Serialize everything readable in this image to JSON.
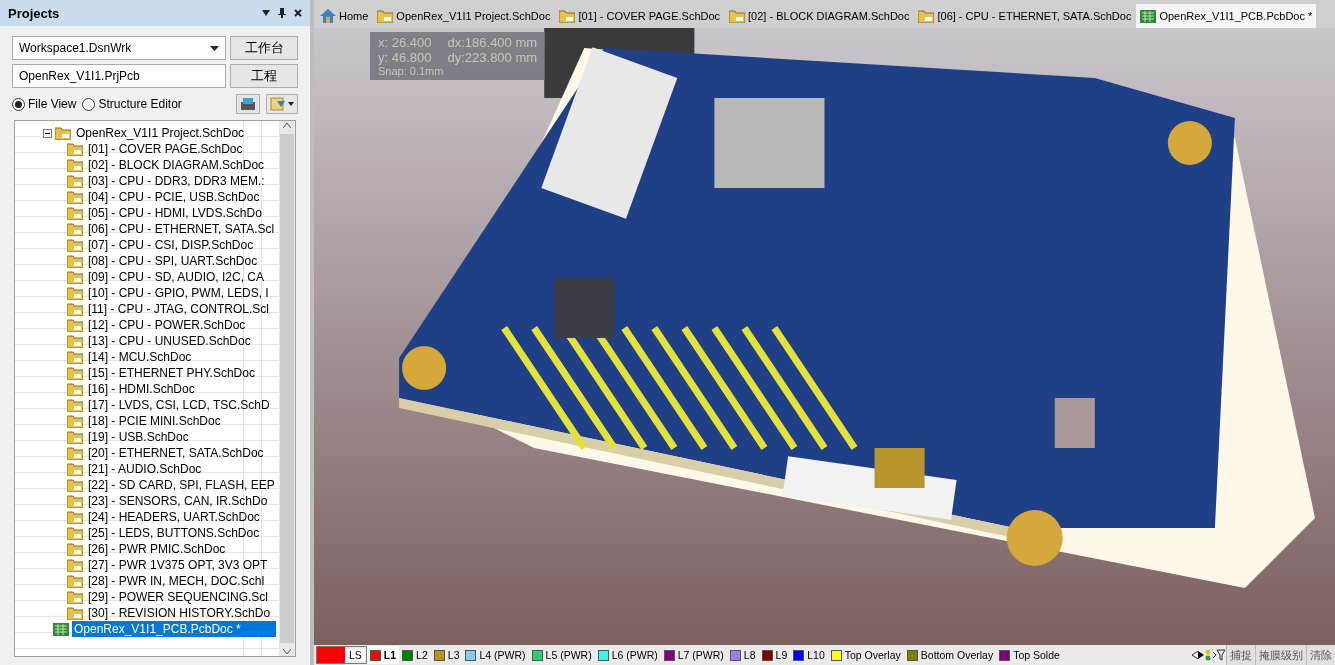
{
  "panel": {
    "title": "Projects",
    "workspace": {
      "value": "Workspace1.DsnWrk",
      "button": "工作台"
    },
    "project": {
      "value": "OpenRex_V1I1.PrjPcb",
      "button": "工程"
    },
    "view_options": [
      {
        "label": "File View",
        "selected": true
      },
      {
        "label": "Structure Editor",
        "selected": false
      }
    ],
    "tree": [
      {
        "label": "OpenRex_V1I1 Project.SchDoc",
        "kind": "sch",
        "expanded": true,
        "selected": false,
        "children": [
          {
            "label": "[01] - COVER PAGE.SchDoc",
            "kind": "sch",
            "selected": false
          },
          {
            "label": "[02] - BLOCK DIAGRAM.SchDoc",
            "kind": "sch",
            "selected": false
          },
          {
            "label": "[03] - CPU - DDR3, DDR3 MEM.:",
            "kind": "sch",
            "selected": false
          },
          {
            "label": "[04] - CPU - PCIE, USB.SchDoc",
            "kind": "sch",
            "selected": false
          },
          {
            "label": "[05] - CPU - HDMI, LVDS.SchDo",
            "kind": "sch",
            "selected": false
          },
          {
            "label": "[06] - CPU - ETHERNET, SATA.Scl",
            "kind": "sch",
            "selected": false
          },
          {
            "label": "[07] - CPU - CSI, DISP.SchDoc",
            "kind": "sch",
            "selected": false
          },
          {
            "label": "[08] - CPU - SPI, UART.SchDoc",
            "kind": "sch",
            "selected": false
          },
          {
            "label": "[09] - CPU - SD, AUDIO, I2C, CA",
            "kind": "sch",
            "selected": false
          },
          {
            "label": "[10] - CPU - GPIO, PWM, LEDS, I",
            "kind": "sch",
            "selected": false
          },
          {
            "label": "[11] - CPU - JTAG, CONTROL.Scl",
            "kind": "sch",
            "selected": false
          },
          {
            "label": "[12] - CPU - POWER.SchDoc",
            "kind": "sch",
            "selected": false
          },
          {
            "label": "[13] - CPU - UNUSED.SchDoc",
            "kind": "sch",
            "selected": false
          },
          {
            "label": "[14] - MCU.SchDoc",
            "kind": "sch",
            "selected": false
          },
          {
            "label": "[15] - ETHERNET PHY.SchDoc",
            "kind": "sch",
            "selected": false
          },
          {
            "label": "[16] - HDMI.SchDoc",
            "kind": "sch",
            "selected": false
          },
          {
            "label": "[17] - LVDS, CSI, LCD, TSC.SchD",
            "kind": "sch",
            "selected": false
          },
          {
            "label": "[18] - PCIE MINI.SchDoc",
            "kind": "sch",
            "selected": false
          },
          {
            "label": "[19] - USB.SchDoc",
            "kind": "sch",
            "selected": false
          },
          {
            "label": "[20] - ETHERNET, SATA.SchDoc",
            "kind": "sch",
            "selected": false
          },
          {
            "label": "[21] - AUDIO.SchDoc",
            "kind": "sch",
            "selected": false
          },
          {
            "label": "[22] - SD CARD, SPI, FLASH, EEP",
            "kind": "sch",
            "selected": false
          },
          {
            "label": "[23] - SENSORS, CAN, IR.SchDo",
            "kind": "sch",
            "selected": false
          },
          {
            "label": "[24] - HEADERS, UART.SchDoc",
            "kind": "sch",
            "selected": false
          },
          {
            "label": "[25] - LEDS, BUTTONS.SchDoc",
            "kind": "sch",
            "selected": false
          },
          {
            "label": "[26] - PWR PMIC.SchDoc",
            "kind": "sch",
            "selected": false
          },
          {
            "label": "[27] - PWR 1V375 OPT, 3V3 OPT",
            "kind": "sch",
            "selected": false
          },
          {
            "label": "[28] - PWR IN, MECH, DOC.SchI",
            "kind": "sch",
            "selected": false
          },
          {
            "label": "[29] - POWER SEQUENCING.Scl",
            "kind": "sch",
            "selected": false
          },
          {
            "label": "[30] - REVISION HISTORY.SchDo",
            "kind": "sch",
            "selected": false
          }
        ]
      },
      {
        "label": "OpenRex_V1I1_PCB.PcbDoc *",
        "kind": "pcb",
        "selected": true
      }
    ]
  },
  "tabs": [
    {
      "label": "Home",
      "kind": "home",
      "selected": false
    },
    {
      "label": "OpenRex_V1I1 Project.SchDoc",
      "kind": "sch",
      "selected": false
    },
    {
      "label": "[01] - COVER PAGE.SchDoc",
      "kind": "sch",
      "selected": false
    },
    {
      "label": "[02] - BLOCK DIAGRAM.SchDoc",
      "kind": "sch",
      "selected": false
    },
    {
      "label": "[06] - CPU - ETHERNET, SATA.SchDoc",
      "kind": "sch",
      "selected": false
    },
    {
      "label": "OpenRex_V1I1_PCB.PcbDoc *",
      "kind": "pcb",
      "selected": true
    }
  ],
  "view": {
    "kind": "picture",
    "coordinates": [
      "x: 26.400",
      "dx:186.400 mm",
      "y: 46.800",
      "dy:223.800 mm"
    ],
    "snap": "Snap: 0.1mm"
  },
  "layer_bar": {
    "current": {
      "label": "LS",
      "color": "#ff0000"
    },
    "layers": [
      {
        "label": "L1",
        "color": "#ff0000",
        "selected": true
      },
      {
        "label": "L2",
        "color": "#008000",
        "selected": false
      },
      {
        "label": "L3",
        "color": "#b8961e",
        "selected": false
      },
      {
        "label": "L4 (PWR)",
        "color": "#87ceeb",
        "selected": false
      },
      {
        "label": "L5 (PWR)",
        "color": "#2ecc71",
        "selected": false
      },
      {
        "label": "L6 (PWR)",
        "color": "#40f0f0",
        "selected": false
      },
      {
        "label": "L7 (PWR)",
        "color": "#800080",
        "selected": false
      },
      {
        "label": "L8",
        "color": "#9b7ee8",
        "selected": false
      },
      {
        "label": "L9",
        "color": "#800000",
        "selected": false
      },
      {
        "label": "L10",
        "color": "#0000ff",
        "selected": false
      },
      {
        "label": "Top Overlay",
        "color": "#ffff00",
        "selected": false
      },
      {
        "label": "Bottom Overlay",
        "color": "#808000",
        "selected": false
      },
      {
        "label": "Top Solde",
        "color": "#800080",
        "selected": false
      }
    ],
    "actions": [
      "捕捉",
      "掩膜级别",
      "清除"
    ]
  }
}
